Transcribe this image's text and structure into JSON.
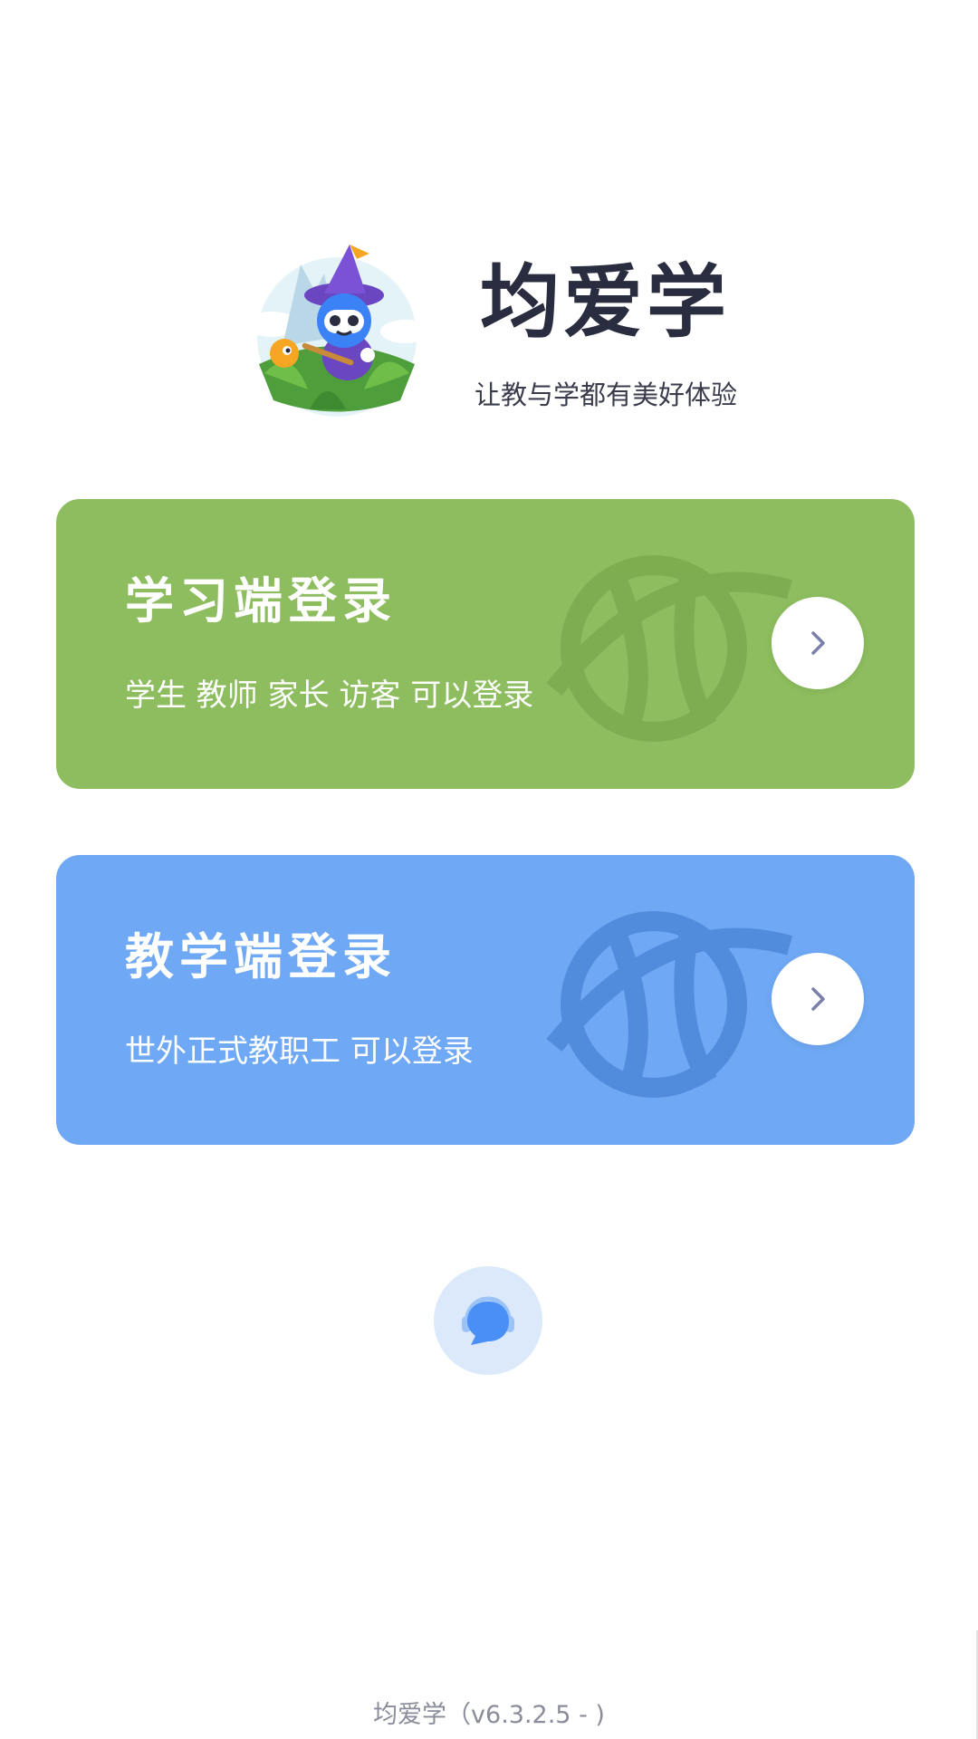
{
  "brand": {
    "app_name": "均爱学",
    "slogan": "让教与学都有美好体验",
    "mascot_icon": "wizard-robot-mascot-icon"
  },
  "login_cards": {
    "student": {
      "title": "学习端登录",
      "description": "学生 教师 家长 访客 可以登录",
      "color": "#8dbd5e",
      "arrow_icon": "chevron-right-icon"
    },
    "teacher": {
      "title": "教学端登录",
      "description": "世外正式教职工 可以登录",
      "color": "#6fa8f4",
      "arrow_icon": "chevron-right-icon"
    }
  },
  "service": {
    "icon": "headset-chat-icon",
    "color": "#4a8ff5"
  },
  "footer": {
    "version": "均爱学（v6.3.2.5 - )"
  }
}
